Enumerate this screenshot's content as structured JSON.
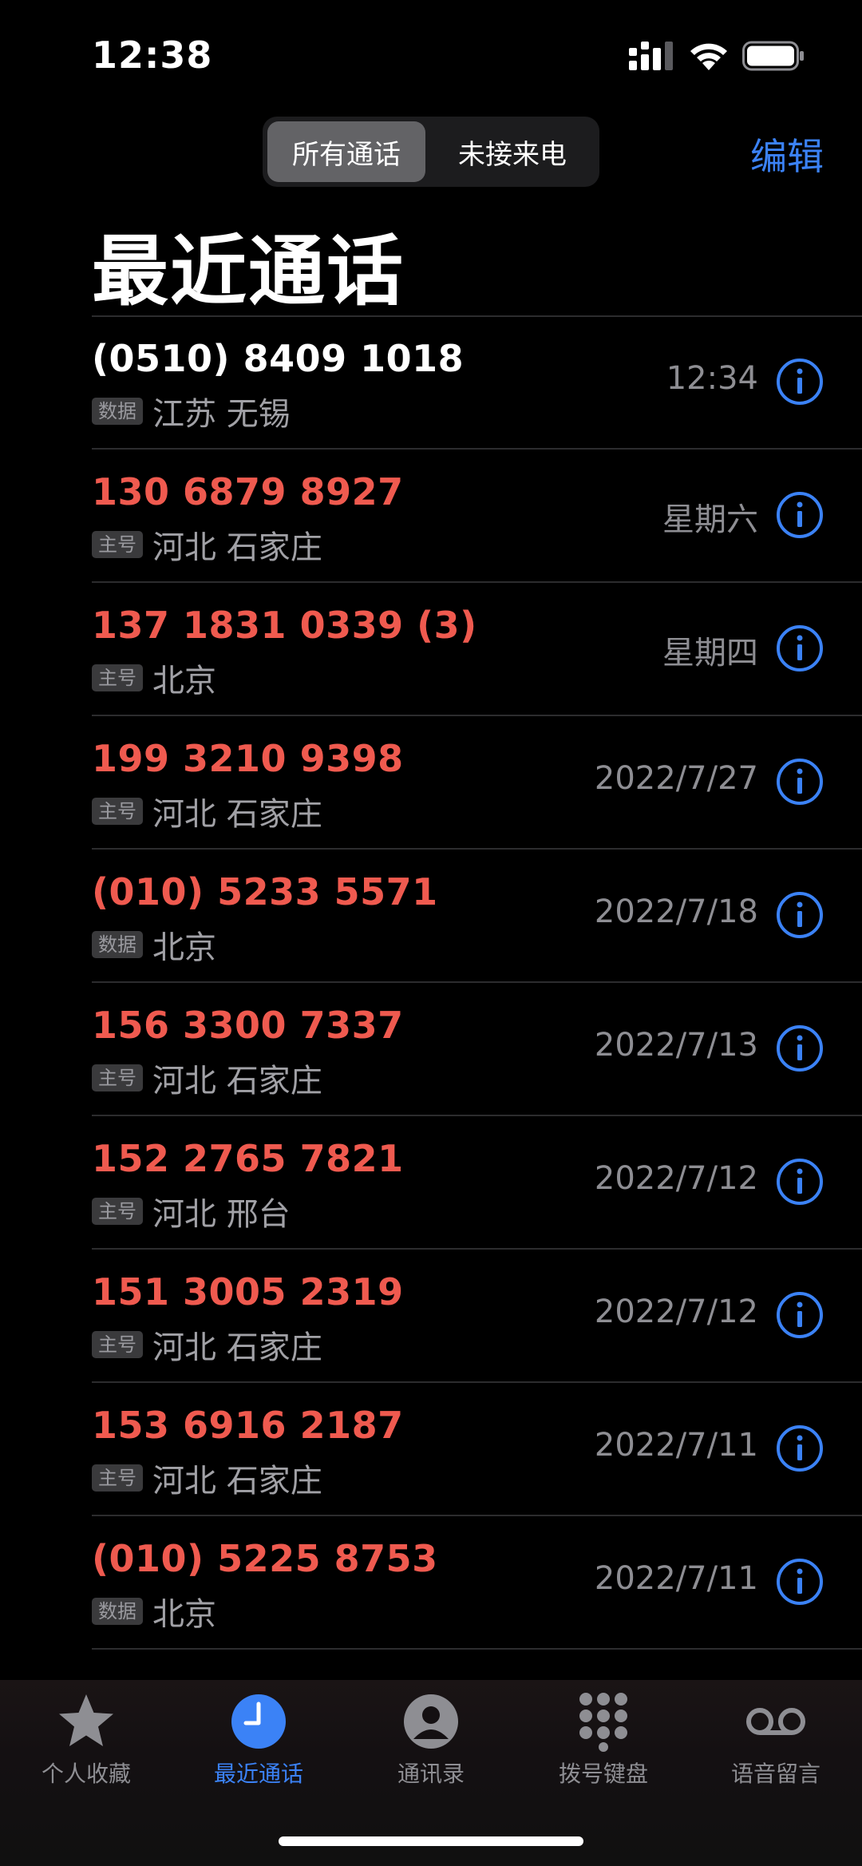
{
  "status_bar": {
    "time": "12:38"
  },
  "header": {
    "segments": [
      "所有通话",
      "未接来电"
    ],
    "edit_label": "编辑",
    "title": "最近通话"
  },
  "calls": [
    {
      "number": "(0510) 8409 1018",
      "badge": "数据",
      "location": "江苏 无锡",
      "date": "12:34",
      "missed": false
    },
    {
      "number": "130 6879 8927",
      "badge": "主号",
      "location": "河北 石家庄",
      "date": "星期六",
      "missed": true
    },
    {
      "number": "137 1831 0339 (3)",
      "badge": "主号",
      "location": "北京",
      "date": "星期四",
      "missed": true
    },
    {
      "number": "199 3210 9398",
      "badge": "主号",
      "location": "河北 石家庄",
      "date": "2022/7/27",
      "missed": true
    },
    {
      "number": "(010) 5233 5571",
      "badge": "数据",
      "location": "北京",
      "date": "2022/7/18",
      "missed": true
    },
    {
      "number": "156 3300 7337",
      "badge": "主号",
      "location": "河北 石家庄",
      "date": "2022/7/13",
      "missed": true
    },
    {
      "number": "152 2765 7821",
      "badge": "主号",
      "location": "河北 邢台",
      "date": "2022/7/12",
      "missed": true
    },
    {
      "number": "151 3005 2319",
      "badge": "主号",
      "location": "河北 石家庄",
      "date": "2022/7/12",
      "missed": true
    },
    {
      "number": "153 6916 2187",
      "badge": "主号",
      "location": "河北 石家庄",
      "date": "2022/7/11",
      "missed": true
    },
    {
      "number": "(010) 5225 8753",
      "badge": "数据",
      "location": "北京",
      "date": "2022/7/11",
      "missed": true
    }
  ],
  "tabs": [
    {
      "label": "个人收藏",
      "icon": "star-icon",
      "active": false
    },
    {
      "label": "最近通话",
      "icon": "clock-icon",
      "active": true
    },
    {
      "label": "通讯录",
      "icon": "person-icon",
      "active": false
    },
    {
      "label": "拨号键盘",
      "icon": "keypad-icon",
      "active": false
    },
    {
      "label": "语音留言",
      "icon": "voicemail-icon",
      "active": false
    }
  ],
  "colors": {
    "accent": "#3b82f6",
    "missed": "#ef5a4f",
    "background": "#000000"
  }
}
